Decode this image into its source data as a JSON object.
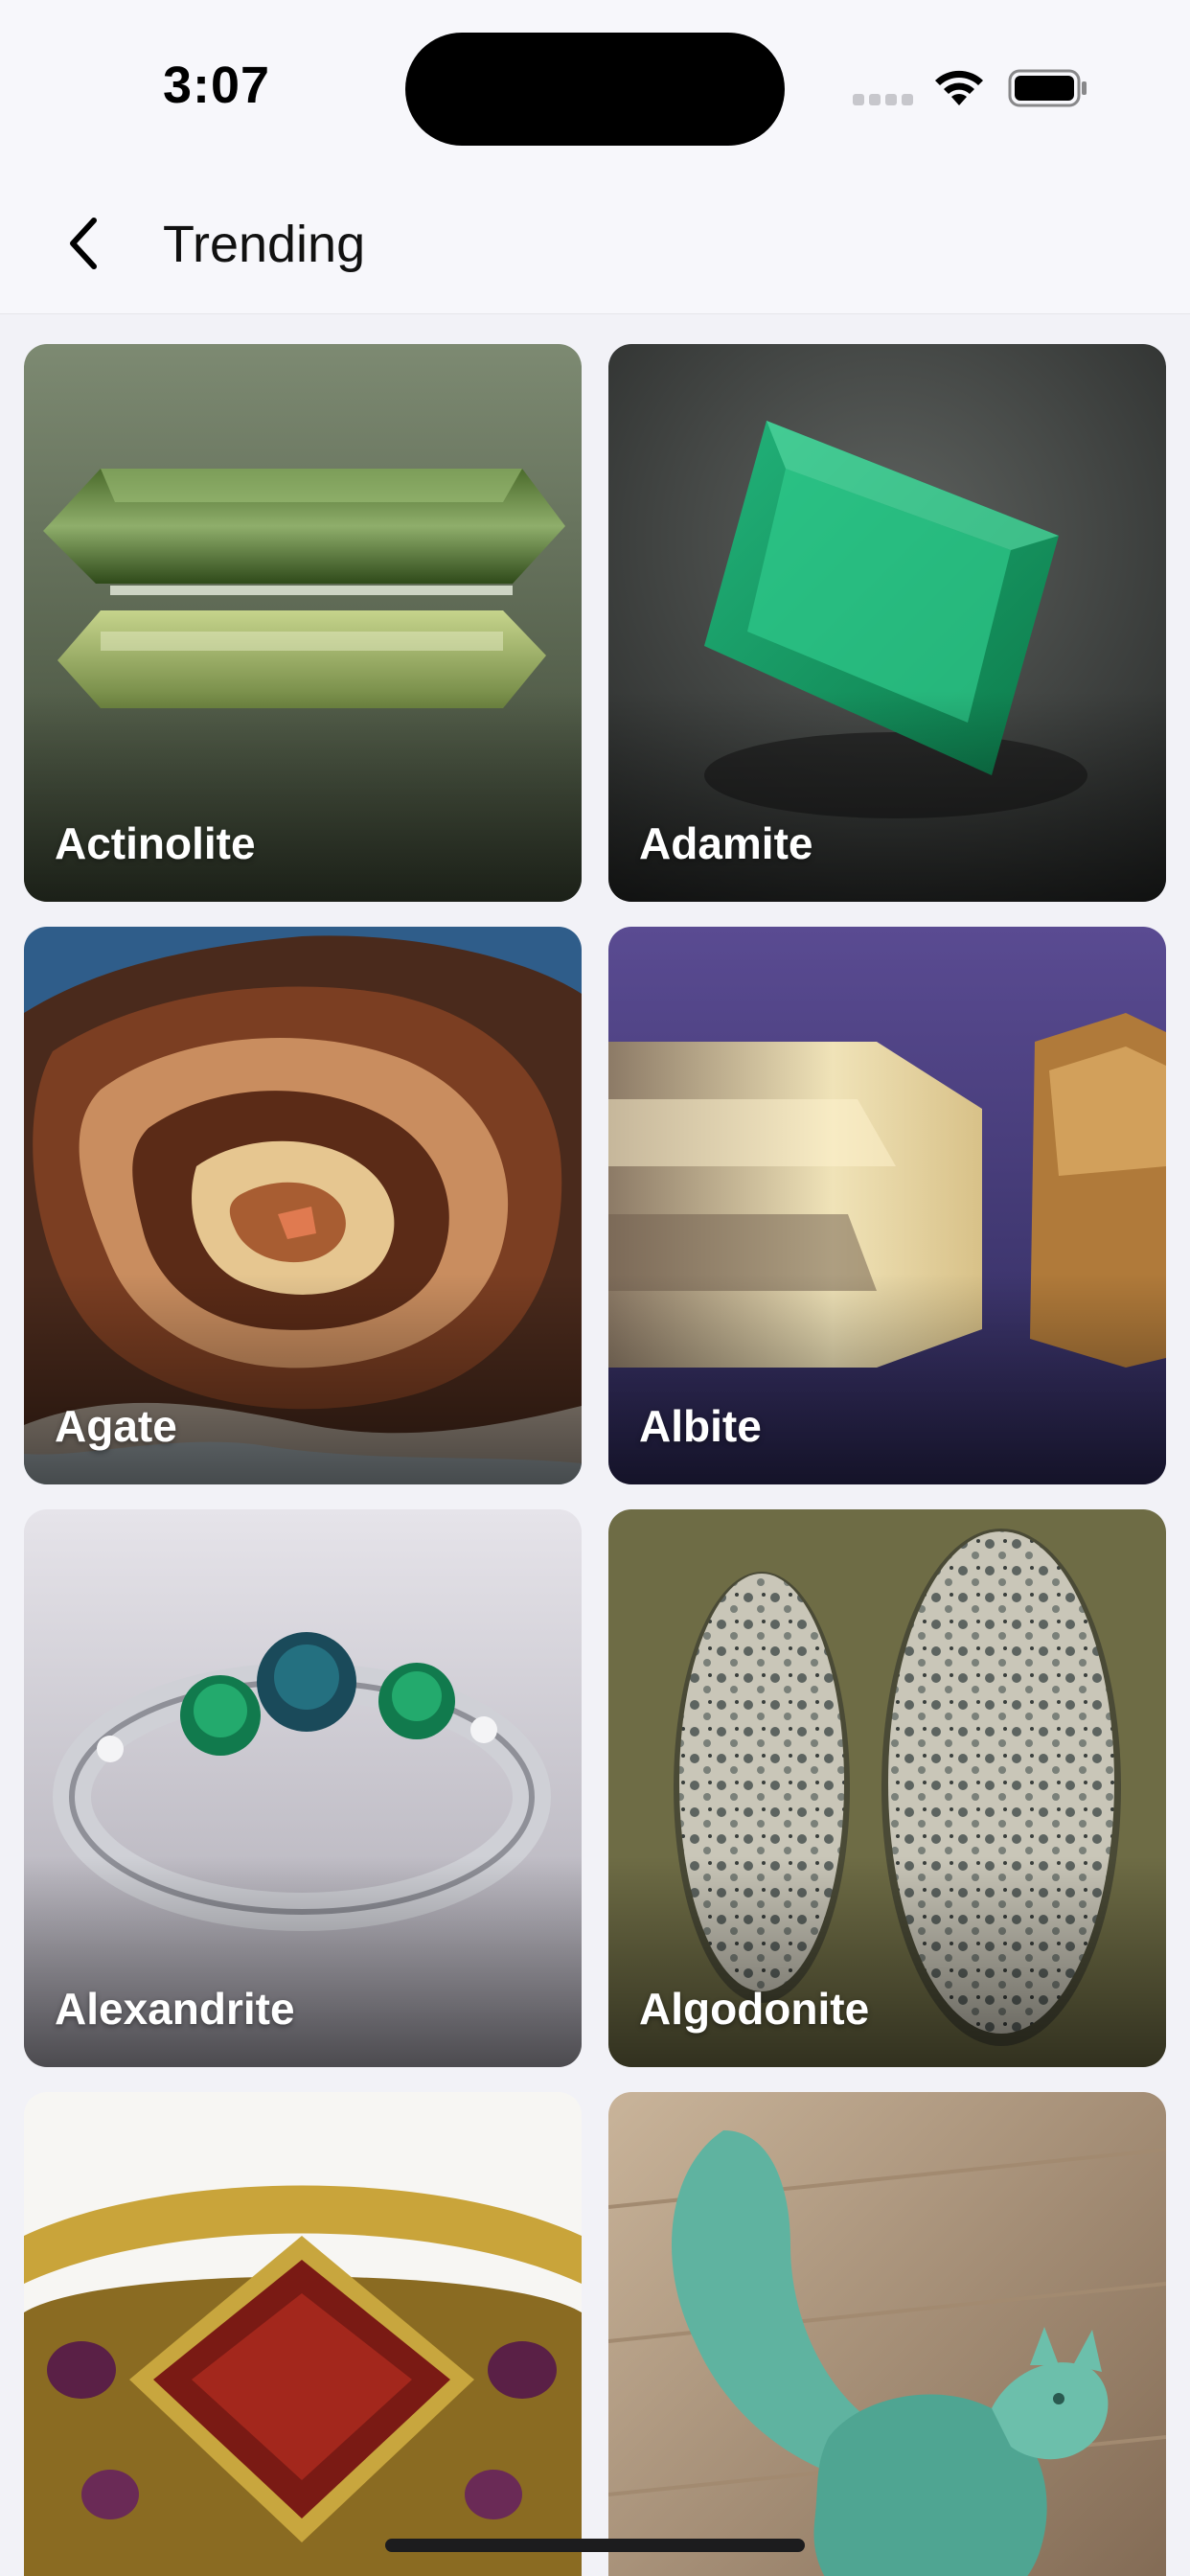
{
  "status_bar": {
    "time": "3:07",
    "icons": [
      "cellular-signal-icon",
      "wifi-icon",
      "battery-icon"
    ]
  },
  "nav": {
    "back_icon": "chevron-left-icon",
    "title": "Trending"
  },
  "cards": [
    {
      "label": "Actinolite",
      "bg": "#5b6752"
    },
    {
      "label": "Adamite",
      "bg": "#3c403d"
    },
    {
      "label": "Agate",
      "bg": "#2f5d8a"
    },
    {
      "label": "Albite",
      "bg": "#4a3f7e"
    },
    {
      "label": "Alexandrite",
      "bg": "#d8d6dc"
    },
    {
      "label": "Algodonite",
      "bg": "#6e6c45"
    },
    {
      "label": "",
      "bg": "#f2f0ec"
    },
    {
      "label": "",
      "bg": "#a08a72"
    }
  ]
}
